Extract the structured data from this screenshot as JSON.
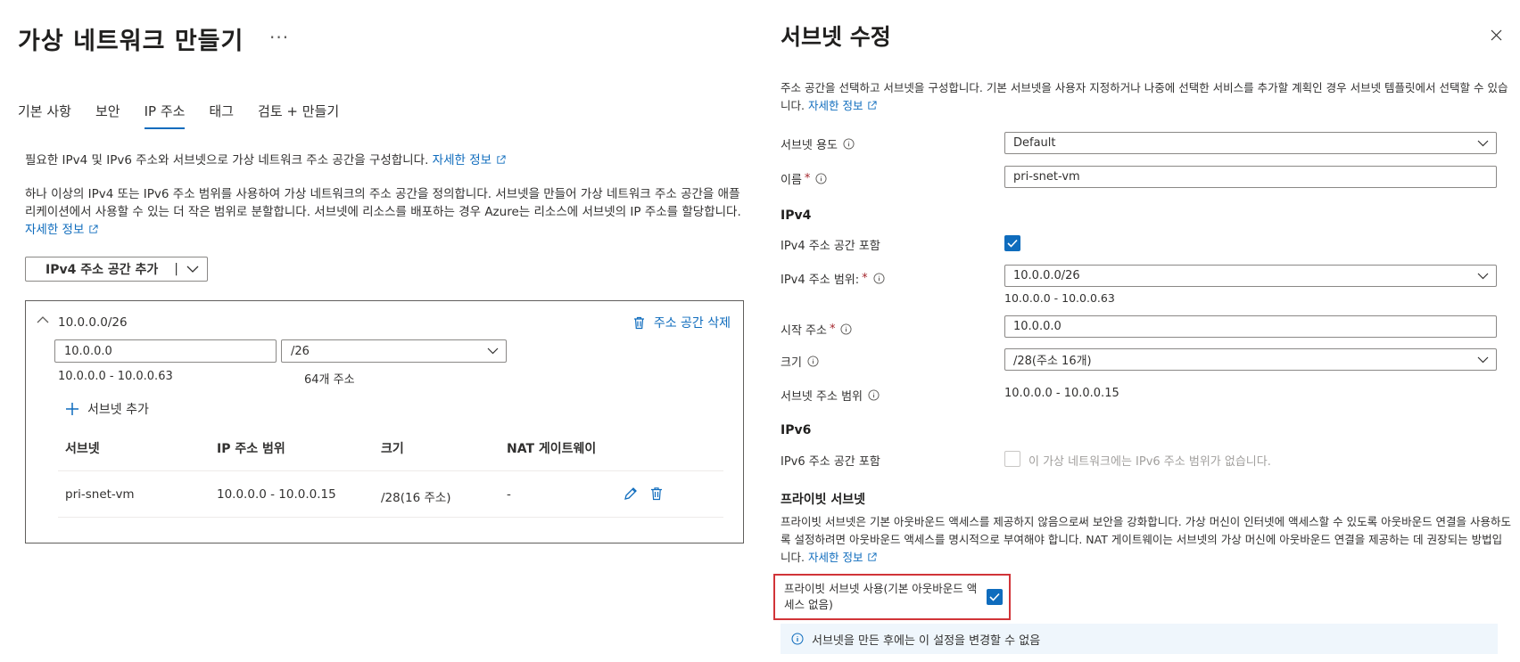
{
  "left": {
    "title": "가상 네트워크 만들기",
    "more": "···",
    "tabs": [
      "기본 사항",
      "보안",
      "IP 주소",
      "태그",
      "검토 + 만들기"
    ],
    "intro": "필요한 IPv4 및 IPv6 주소와 서브넷으로 가상 네트워크 주소 공간을 구성합니다.",
    "learn_more": "자세한 정보",
    "description": "하나 이상의 IPv4 또는 IPv6 주소 범위를 사용하여 가상 네트워크의 주소 공간을 정의합니다. 서브넷을 만들어 가상 네트워크 주소 공간을 애플리케이션에서 사용할 수 있는 더 작은 범위로 분할합니다. 서브넷에 리소스를 배포하는 경우 Azure는 리소스에 서브넷의 IP 주소를 할당합니다.",
    "add_space_button": "IPv4 주소 공간 추가",
    "add_space_separator": "|",
    "address_space": {
      "cidr": "10.0.0.0/26",
      "delete_label": "주소 공간 삭제",
      "address_value": "10.0.0.0",
      "prefix_value": "/26",
      "range": "10.0.0.0 - 10.0.0.63",
      "count": "64개 주소",
      "add_subnet": "서브넷 추가"
    },
    "subnet_table": {
      "columns": [
        "서브넷",
        "IP 주소 범위",
        "크기",
        "NAT 게이트웨이"
      ],
      "rows": [
        {
          "name": "pri-snet-vm",
          "range": "10.0.0.0 - 10.0.0.15",
          "size": "/28(16 주소)",
          "nat": "-"
        }
      ]
    }
  },
  "right": {
    "title": "서브넷 수정",
    "description": "주소 공간을 선택하고 서브넷을 구성합니다. 기본 서브넷을 사용자 지정하거나 나중에 선택한 서비스를 추가할 계획인 경우 서브넷 템플릿에서 선택할 수 있습니다.",
    "learn_more": "자세한 정보",
    "purpose_label": "서브넷 용도",
    "purpose_value": "Default",
    "name_label": "이름",
    "required_mark": "*",
    "name_value": "pri-snet-vm",
    "ipv4_heading": "IPv4",
    "ipv4_include_label": "IPv4 주소 공간 포함",
    "ipv4_range_label": "IPv4 주소 범위:",
    "ipv4_range_value": "10.0.0.0/26",
    "ipv4_range_hint": "10.0.0.0 - 10.0.0.63",
    "start_label": "시작 주소",
    "start_value": "10.0.0.0",
    "size_label": "크기",
    "size_value": "/28(주소 16개)",
    "subnet_range_label": "서브넷 주소 범위",
    "subnet_range_value": "10.0.0.0 - 10.0.0.15",
    "ipv6_heading": "IPv6",
    "ipv6_include_label": "IPv6 주소 공간 포함",
    "ipv6_note": "이 가상 네트워크에는 IPv6 주소 범위가 없습니다.",
    "private_heading": "프라이빗 서브넷",
    "private_description": "프라이빗 서브넷은 기본 아웃바운드 액세스를 제공하지 않음으로써 보안을 강화합니다. 가상 머신이 인터넷에 액세스할 수 있도록 아웃바운드 연결을 사용하도록 설정하려면 아웃바운드 액세스를 명시적으로 부여해야 합니다. NAT 게이트웨이는 서브넷의 가상 머신에 아웃바운드 연결을 제공하는 데 권장되는 방법입니다.",
    "private_enable_label": "프라이빗 서브넷 사용(기본 아웃바운드 액세스 없음)",
    "info_message": "서브넷을 만든 후에는 이 설정을 변경할 수 없음"
  },
  "colors": {
    "accent": "#0f6cbd",
    "highlight": "#d13438",
    "info_bg": "#eff6fc"
  }
}
